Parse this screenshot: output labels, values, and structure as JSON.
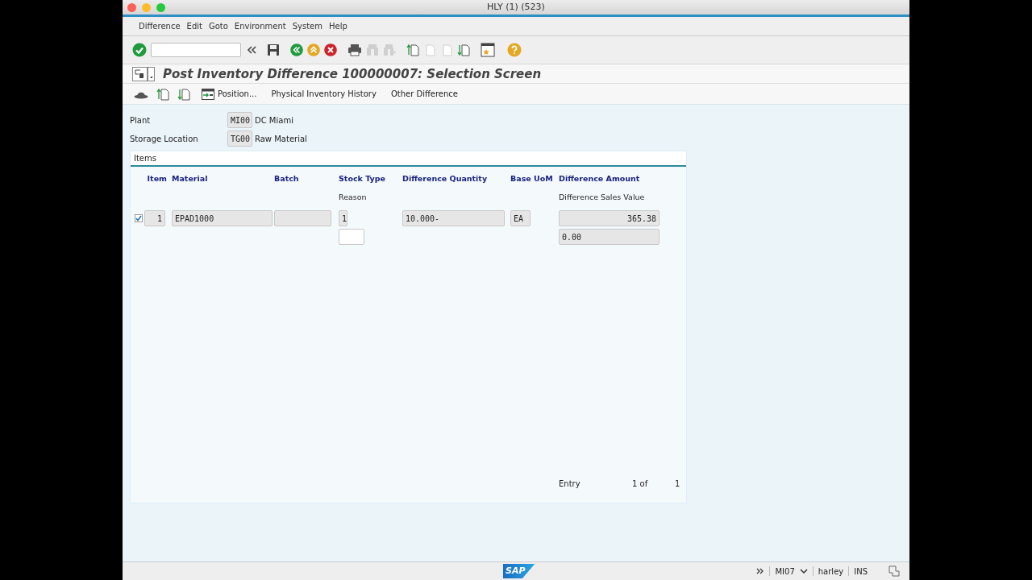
{
  "window": {
    "title": "HLY (1) (523)"
  },
  "menu": [
    "Difference",
    "Edit",
    "Goto",
    "Environment",
    "System",
    "Help"
  ],
  "toolbar": [
    {
      "kind": "enter",
      "disabled": false
    },
    {
      "kind": "field"
    },
    {
      "kind": "collapse",
      "disabled": false
    },
    {
      "kind": "save",
      "disabled": false
    },
    {
      "kind": "back",
      "disabled": false
    },
    {
      "kind": "exit",
      "disabled": false
    },
    {
      "kind": "cancel",
      "disabled": false
    },
    {
      "kind": "print",
      "disabled": false
    },
    {
      "kind": "find",
      "disabled": true
    },
    {
      "kind": "find_next",
      "disabled": true
    },
    {
      "kind": "first_page",
      "disabled": false
    },
    {
      "kind": "prev_page",
      "disabled": true
    },
    {
      "kind": "next_page",
      "disabled": true
    },
    {
      "kind": "last_page",
      "disabled": false
    },
    {
      "kind": "shortcut",
      "disabled": false
    },
    {
      "kind": "help",
      "disabled": false
    }
  ],
  "screen_title": "Post Inventory Difference 100000007: Selection Screen",
  "app_toolbar": [
    {
      "kind": "hat"
    },
    {
      "kind": "first"
    },
    {
      "kind": "last"
    },
    {
      "kind": "position",
      "label": "Position..."
    },
    {
      "kind": "text",
      "label": "Physical Inventory History"
    },
    {
      "kind": "text",
      "label": "Other Difference"
    }
  ],
  "header_fields": [
    {
      "label": "Plant",
      "value": "MI00",
      "description": "DC Miami"
    },
    {
      "label": "Storage Location",
      "value": "TG00",
      "description": "Raw Material"
    }
  ],
  "items_panel": {
    "title": "Items",
    "columns": [
      {
        "label": "Item"
      },
      {
        "label": "Material"
      },
      {
        "label": "Batch"
      },
      {
        "label": "Stock Type",
        "sub_label": "Reason"
      },
      {
        "label": "Difference Quantity"
      },
      {
        "label": "Base UoM"
      },
      {
        "label": "Difference Amount",
        "sub_label": "Difference Sales Value"
      }
    ],
    "rows": [
      {
        "checked": true,
        "fields": [
          {
            "kind": "display",
            "text": "1"
          },
          {
            "kind": "display",
            "text": "EPAD1000"
          },
          {
            "kind": "display"
          },
          {
            "kind": "display",
            "text": "1"
          },
          {
            "kind": "display",
            "text": "10.000-"
          },
          {
            "kind": "display",
            "text": "EA"
          },
          {
            "kind": "display",
            "text": "365.38"
          }
        ],
        "sub_fields": [
          {
            "kind": "input"
          },
          {
            "kind": "display",
            "text": "0.00"
          }
        ]
      }
    ],
    "entry": {
      "label": "Entry",
      "position": "1 of",
      "total": "1"
    }
  },
  "status_bar": {
    "logo": "SAP",
    "transaction": "MI07",
    "user": "harley",
    "mode": "INS"
  }
}
